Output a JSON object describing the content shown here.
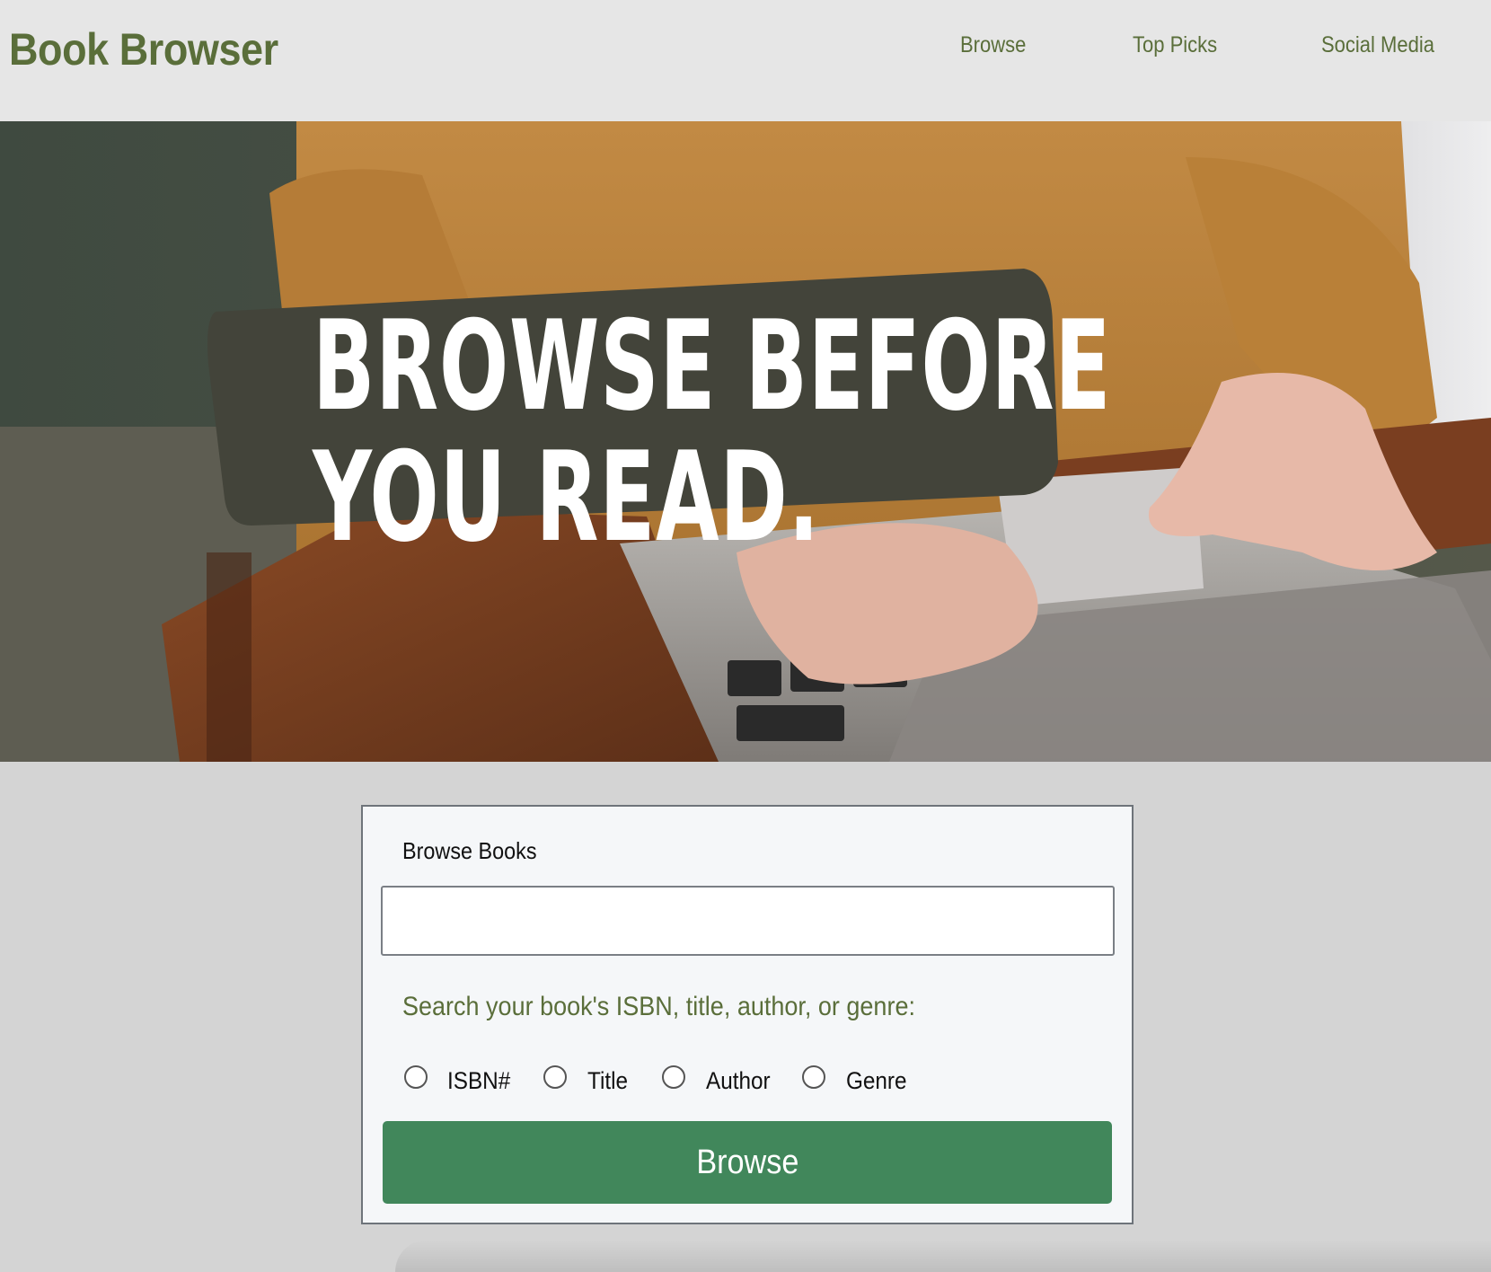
{
  "header": {
    "brand": "Book Browser",
    "nav": {
      "browse": "Browse",
      "top_picks": "Top Picks",
      "social_media": "Social Media"
    }
  },
  "hero": {
    "headline_line1": "BROWSE BEFORE",
    "headline_line2": "YOU READ."
  },
  "search_card": {
    "title": "Browse Books",
    "input_value": "",
    "hint": "Search your book's ISBN, title, author, or genre:",
    "options": {
      "isbn": "ISBN#",
      "title": "Title",
      "author": "Author",
      "genre": "Genre"
    },
    "button_label": "Browse"
  },
  "colors": {
    "brand_green": "#5a6e3a",
    "button_green": "#41875b",
    "header_bg": "#e6e6e6",
    "page_bg": "#d4d4d4",
    "headline_band": "#43443a"
  }
}
